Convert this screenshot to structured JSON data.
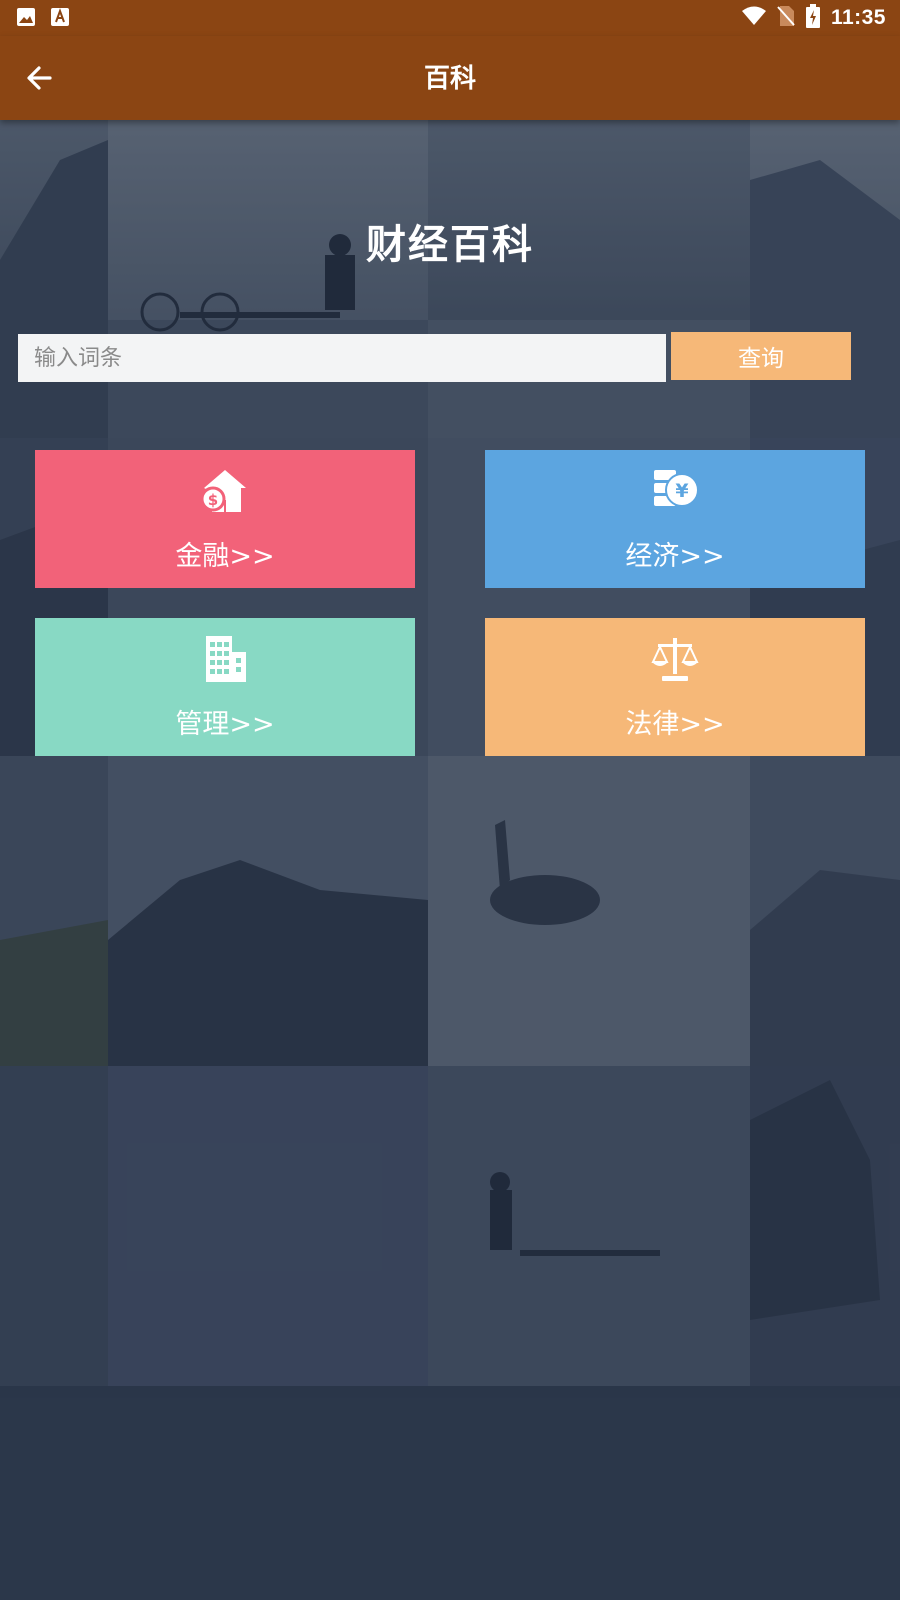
{
  "status_bar": {
    "time": "11:35",
    "left_icons": [
      "image-icon",
      "font-icon"
    ],
    "right_icons": [
      "wifi-icon",
      "no-sim-icon",
      "battery-charging-icon"
    ]
  },
  "toolbar": {
    "title": "百科",
    "back_icon": "back-arrow-icon"
  },
  "main": {
    "title": "财经百科",
    "search": {
      "placeholder": "输入词条",
      "value": "",
      "button_label": "查询"
    },
    "categories": [
      {
        "label": "金融>>",
        "icon": "money-house-icon",
        "color": "#f26279"
      },
      {
        "label": "经济>>",
        "icon": "yuan-coins-icon",
        "color": "#5ca5e0"
      },
      {
        "label": "管理>>",
        "icon": "building-icon",
        "color": "#88d9c4"
      },
      {
        "label": "法律>>",
        "icon": "scale-icon",
        "color": "#f6b878"
      }
    ]
  },
  "colors": {
    "brand": "#8b4513",
    "search_button": "#f6b878"
  }
}
